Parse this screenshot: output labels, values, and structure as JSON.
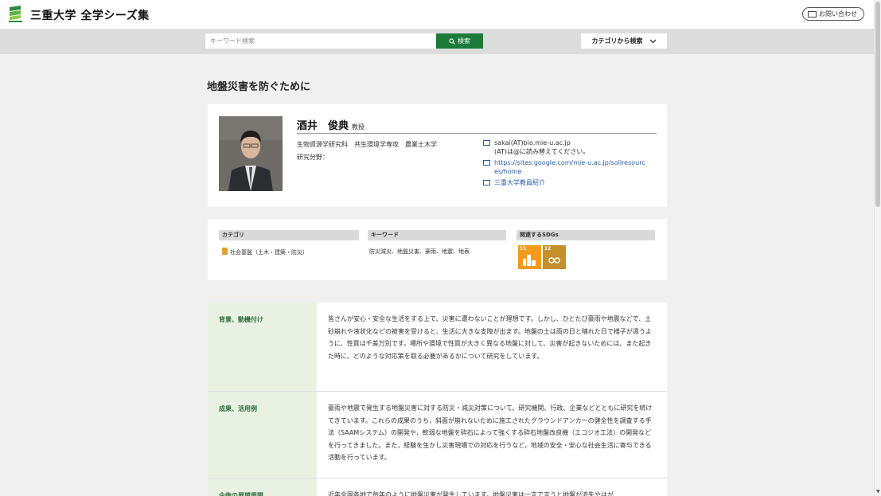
{
  "header": {
    "site_title": "三重大学 全学シーズ集",
    "contact_label": "お問い合わせ",
    "brand_color": "#1c7a3b"
  },
  "search": {
    "placeholder": "キーワード検索",
    "button_label": "検索",
    "category_label": "カテゴリから検索"
  },
  "page": {
    "title": "地盤災害を防ぐために"
  },
  "profile": {
    "name": "酒井　俊典",
    "position": "教授",
    "department": "生物資源学研究科　共生環境学専攻　農業土木学",
    "research_field_label": "研究分野：",
    "email": "sakai(AT)bio.mie-u.ac.jp",
    "email_note": "(AT)は@に読み替えてください。",
    "website": "https://sites.google.com/mie-u.ac.jp/soilresources/home",
    "website_line1": "https://sites.google.com/mie-u.ac.jp/soilresourc",
    "website_line2": "es/home",
    "faculty_link": "三重大学教員紹介"
  },
  "meta": {
    "category_head": "カテゴリ",
    "category_value": "社会基盤（土木・建築・防災）",
    "keyword_head": "キーワード",
    "keyword_value": "防災減災、地盤災害、豪雨、地震、地表",
    "sdgs_head": "関連するSDGs",
    "sdgs": [
      "11",
      "12"
    ]
  },
  "sections": [
    {
      "label": "背景、動機付け",
      "text": "皆さんが安心・安全な生活をする上で、災害に遭わないことが理想です。しかし、ひとたび豪雨や地震などで、土砂崩れや液状化などの被害を受けると、生活に大きな支障が出ます。地盤の土は雨の日と晴れた日で様子が違うように、性質は千差万別です。場所や環境で性質が大きく異なる地盤に対して、災害が起きないためには、また起きた時に、どのような対応策を取る必要があるかについて研究をしています。"
    },
    {
      "label": "成果、活用例",
      "text": "豪雨や地震で発生する地盤災害に対する防災・減災対策について、研究機関、行政、企業などとともに研究を続けてきています。これらの成果のうち，斜面が崩れないために施工されたグラウンドアンカーの健全性を調査する手法（SAAMシステム）の開発や，軟弱な地盤を砕石によって強くする砕石地盤改良機（エコジオ工法）の開発などを行ってきました。また，経験を生かし災害現場での対応を行うなど，地域の安全・安心な社会生活に寄与できる活動を行っています。"
    },
    {
      "label": "今後の展望展開",
      "text": "近年全国各地で毎年のように地盤災害が発生しています。地盤災害は一言で言うと地盤が流失やはが"
    }
  ]
}
